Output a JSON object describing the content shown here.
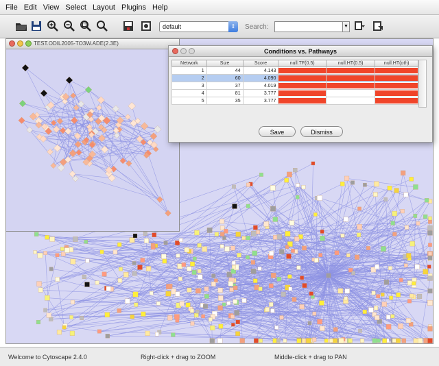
{
  "menu": {
    "items": [
      "File",
      "Edit",
      "View",
      "Select",
      "Layout",
      "Plugins",
      "Help"
    ]
  },
  "toolbar": {
    "icons": [
      "open-folder-icon",
      "save-icon",
      "zoom-in-icon",
      "zoom-out-icon",
      "zoom-selected-icon",
      "zoom-fit-icon",
      "floppy-icon",
      "screenshot-icon"
    ],
    "layout_select": "default",
    "search_label": "Search:",
    "search_value": ""
  },
  "subwindow": {
    "title": "TEST.ODIL2005-TO3W.ADE(2.3E)"
  },
  "dialog": {
    "title": "Conditions vs. Pathways",
    "columns": [
      "Network",
      "Size",
      "Score",
      "null:TF(0.5)",
      "null:HT(0.5)",
      "null:HT(oth)"
    ],
    "rows": [
      {
        "network": "1",
        "size": "44",
        "score": "4.143",
        "bars": [
          1.0,
          1.0,
          1.0
        ]
      },
      {
        "network": "2",
        "size": "60",
        "score": "4.090",
        "bars": [
          1.0,
          1.0,
          1.0
        ]
      },
      {
        "network": "3",
        "size": "37",
        "score": "4.019",
        "bars": [
          1.0,
          1.0,
          1.0
        ]
      },
      {
        "network": "4",
        "size": "81",
        "score": "3.777",
        "bars": [
          1.0,
          0,
          1.0
        ]
      },
      {
        "network": "5",
        "size": "35",
        "score": "3.777",
        "bars": [
          1.0,
          0,
          1.0
        ]
      }
    ],
    "save_label": "Save",
    "dismiss_label": "Dismiss"
  },
  "status": {
    "left": "Welcome to Cytoscape 2.4.0",
    "middle": "Right-click + drag to ZOOM",
    "right": "Middle-click + drag to PAN"
  },
  "colors": {
    "canvas_bg": "#d8d8f4",
    "edge": "#8e93e3",
    "bar_red": "#f0452a",
    "selected_row": "#b5cdf1"
  }
}
